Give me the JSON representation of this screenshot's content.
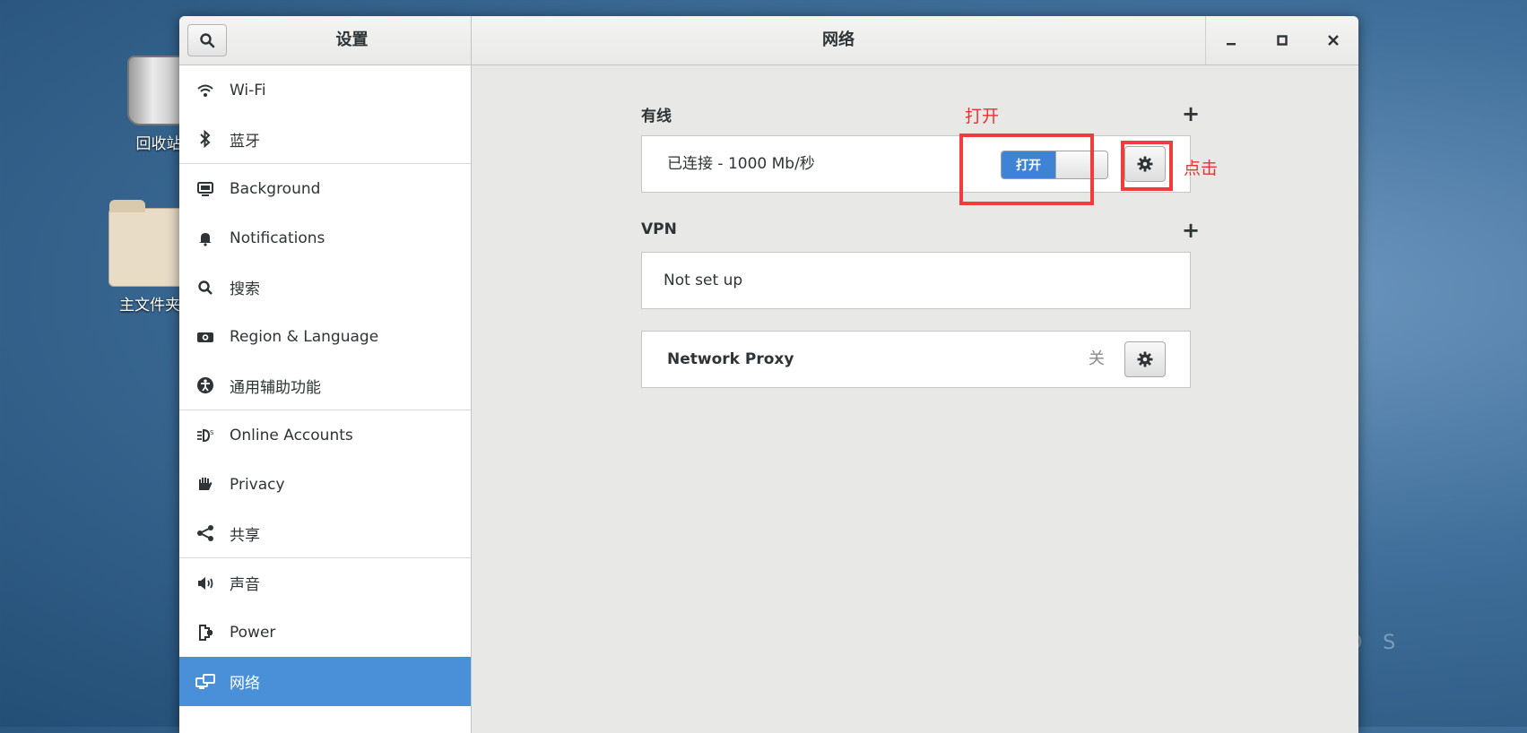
{
  "desktop": {
    "trash_label": "回收站",
    "home_label": "主文件夹",
    "watermark": "O S"
  },
  "window": {
    "sidebar_title": "设置",
    "title": "网络"
  },
  "sidebar": {
    "items": [
      {
        "label": "Wi-Fi"
      },
      {
        "label": "蓝牙"
      },
      {
        "label": "Background"
      },
      {
        "label": "Notifications"
      },
      {
        "label": "搜索"
      },
      {
        "label": "Region & Language"
      },
      {
        "label": "通用辅助功能"
      },
      {
        "label": "Online Accounts"
      },
      {
        "label": "Privacy"
      },
      {
        "label": "共享"
      },
      {
        "label": "声音"
      },
      {
        "label": "Power"
      },
      {
        "label": "网络"
      }
    ],
    "active_index": 12
  },
  "wired": {
    "section_label": "有线",
    "status": "已连接 - 1000 Mb/秒",
    "toggle_label": "打开"
  },
  "vpn": {
    "section_label": "VPN",
    "status": "Not set up"
  },
  "proxy": {
    "label": "Network Proxy",
    "state": "关"
  },
  "annotations": {
    "toggle_note": "打开",
    "gear_note": "点击",
    "color": "#f03c3c"
  },
  "colors": {
    "accent": "#4a90d9",
    "toggle_on": "#3e83d6"
  }
}
